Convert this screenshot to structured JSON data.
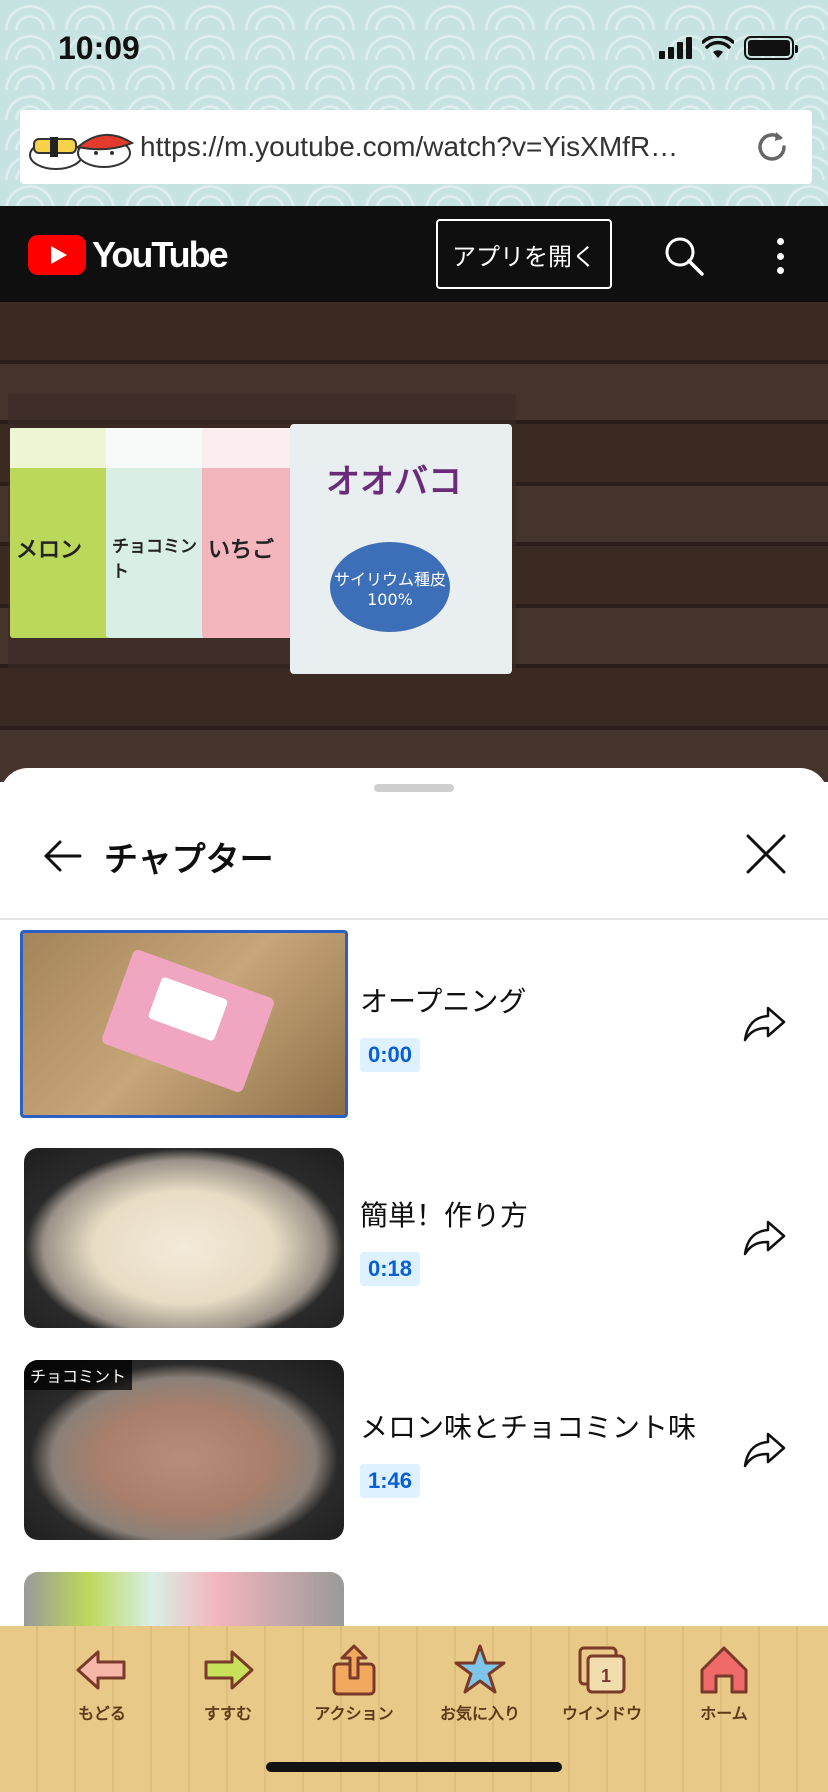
{
  "status_bar": {
    "time": "10:09"
  },
  "browser": {
    "url": "https://m.youtube.com/watch?v=YisXMfR…",
    "reload_icon": "reload-icon",
    "logo_icon": "sushi-logo-icon"
  },
  "youtube_header": {
    "logo_text": "YouTube",
    "open_app_label": "アプリを開く",
    "search_icon": "search-icon",
    "more_icon": "more-vert-icon"
  },
  "video": {
    "cartons": [
      "メロン",
      "チョコミント",
      "いちご"
    ],
    "bag_title": "オオバコ",
    "bag_badge": "サイリウム種皮 100%"
  },
  "chapters_panel": {
    "title": "チャプター",
    "back_icon": "back-arrow-icon",
    "close_icon": "close-icon",
    "chapters": [
      {
        "title": "オープニング",
        "time": "0:00",
        "selected": true,
        "thumb_tag": ""
      },
      {
        "title": "簡単！作り方",
        "time": "0:18",
        "selected": false,
        "thumb_tag": ""
      },
      {
        "title": "メロン味とチョコミント味",
        "time": "1:46",
        "selected": false,
        "thumb_tag": "チョコミント"
      }
    ]
  },
  "toolbar": {
    "items": [
      {
        "label": "もどる",
        "icon": "back-arrow-icon"
      },
      {
        "label": "すすむ",
        "icon": "forward-arrow-icon"
      },
      {
        "label": "アクション",
        "icon": "share-action-icon"
      },
      {
        "label": "お気に入り",
        "icon": "star-icon"
      },
      {
        "label": "ウインドウ",
        "icon": "window-icon"
      },
      {
        "label": "ホーム",
        "icon": "home-icon"
      }
    ],
    "window_count": "1"
  },
  "colors": {
    "youtube_red": "#ff0000",
    "time_badge_bg": "#def1ff",
    "time_badge_text": "#065fd4",
    "toolbar_bg": "#e8c987"
  }
}
